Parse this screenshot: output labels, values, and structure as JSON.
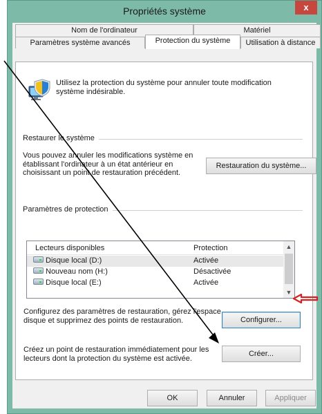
{
  "window": {
    "title": "Propriétés système",
    "close_label": "x"
  },
  "tabs": {
    "row1": [
      "Nom de l'ordinateur",
      "Matériel"
    ],
    "row2": [
      "Paramètres système avancés",
      "Protection du système",
      "Utilisation à distance"
    ],
    "active": "Protection du système"
  },
  "intro": "Utilisez la protection du système pour annuler toute modification système indésirable.",
  "restore": {
    "group_title": "Restaurer le système",
    "description": "Vous pouvez annuler les modifications système en établissant l'ordinateur à un état antérieur en choisissant un point de restauration précédent.",
    "button_label": "Restauration du système..."
  },
  "protection": {
    "group_title": "Paramètres de protection",
    "columns": [
      "Lecteurs disponibles",
      "Protection"
    ],
    "drives": [
      {
        "name": "Disque local (D:)",
        "status": "Activée"
      },
      {
        "name": "Nouveau nom (H:)",
        "status": "Désactivée"
      },
      {
        "name": "Disque local (E:)",
        "status": "Activée"
      }
    ],
    "configure_text": "Configurez des paramètres de restauration, gérez l'espace disque et supprimez des points de restauration.",
    "configure_label": "Configurer...",
    "create_text": "Créez un point de restauration immédiatement pour les lecteurs dont la protection du système est activée.",
    "create_label": "Créer..."
  },
  "footer": {
    "ok_label": "OK",
    "cancel_label": "Annuler",
    "apply_label": "Appliquer"
  },
  "colors": {
    "frame": "#7dbaa8",
    "close": "#c7463d",
    "annotation_arrow": "#d8201f"
  }
}
